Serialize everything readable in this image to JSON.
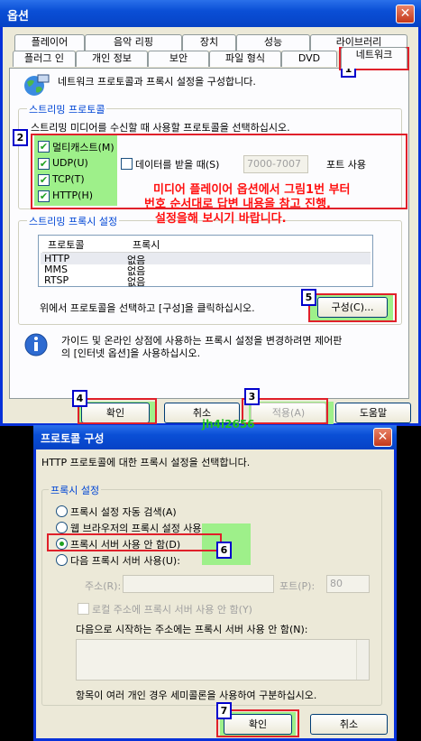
{
  "options_window": {
    "title": "옵션",
    "tabs_row1": [
      "플레이어",
      "음악 리핑",
      "장치",
      "성능",
      "라이브러리"
    ],
    "tabs_row2": [
      "플러그 인",
      "개인 정보",
      "보안",
      "파일 형식",
      "DVD",
      "네트워크"
    ],
    "description": "네트워크 프로토콜과 프록시 설정을 구성합니다.",
    "streaming_protocols": {
      "title": "스트리밍 프로토콜",
      "instruction": "스트리밍 미디어를 수신할 때 사용할 프로토콜을 선택하십시오.",
      "multicast_label": "멀티캐스트(M)",
      "udp_label": "UDP(U)",
      "tcp_label": "TCP(T)",
      "http_label": "HTTP(H)",
      "data_port_label": "데이터를 받을 때(S)",
      "port_range": "7000-7007",
      "port_use_label": "포트 사용"
    },
    "streaming_proxy": {
      "title": "스트리밍 프록시 설정",
      "col_protocol": "프로토콜",
      "col_proxy": "프록시",
      "rows": [
        {
          "protocol": "HTTP",
          "proxy": "없음"
        },
        {
          "protocol": "MMS",
          "proxy": "없음"
        },
        {
          "protocol": "RTSP",
          "proxy": "없음"
        }
      ],
      "hint": "위에서 프로토콜을 선택하고 [구성]을 클릭하십시오.",
      "configure_button": "구성(C)..."
    },
    "info_text_line1": "가이드 및 온라인 상점에 사용하는 프록시 설정을 변경하려면 제어판",
    "info_text_line2": "의 [인터넷 옵션]을 사용하십시오.",
    "buttons": {
      "ok": "확인",
      "cancel": "취소",
      "apply": "적용(A)",
      "help": "도움말"
    }
  },
  "annotation": {
    "line1": "미디어 플레이어 옵션에서 그림1번 부터",
    "line2": "번호 순서대로 답변 내용을 참고 진행,",
    "line3": "설정을해 보시기 바랍니다.",
    "watermark": "jh4i2656",
    "numbers": [
      "1",
      "2",
      "3",
      "4",
      "5",
      "6",
      "7"
    ]
  },
  "protocol_dialog": {
    "title": "프로토콜 구성",
    "description": "HTTP 프로토콜에 대한 프록시 설정을 선택합니다.",
    "group_title": "프록시 설정",
    "radio_auto": "프록시 설정 자동 검색(A)",
    "radio_browser": "웹 브라우저의 프록시 설정 사용(B)",
    "radio_none": "프록시 서버 사용 안 함(D)",
    "radio_custom": "다음 프록시 서버 사용(U):",
    "address_label": "주소(R):",
    "port_label": "포트(P):",
    "port_value": "80",
    "bypass_local": "로컬 주소에 프록시 서버 사용 안 함(Y)",
    "bypass_list_label": "다음으로 시작하는 주소에는 프록시 서버 사용 안 함(N):",
    "footer_hint": "항목이 여러 개인 경우 세미콜론을 사용하여 구분하십시오.",
    "ok": "확인",
    "cancel": "취소"
  }
}
